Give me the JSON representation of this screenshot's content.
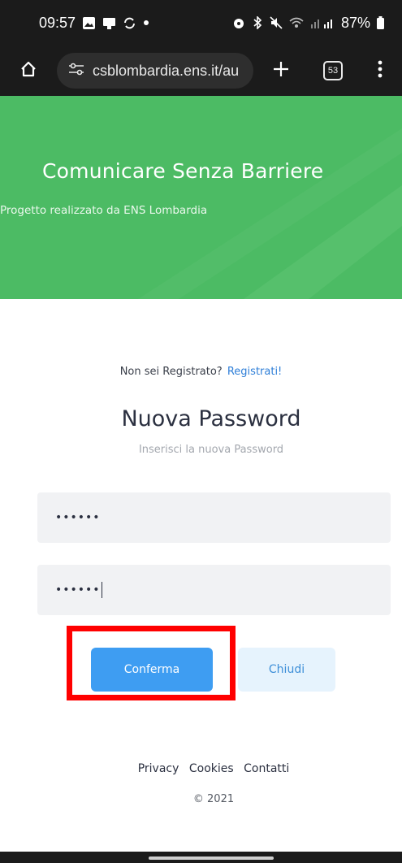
{
  "status_bar": {
    "time": "09:57",
    "battery": "87%"
  },
  "browser": {
    "url": "csblombardia.ens.it/au",
    "tab_count": "53"
  },
  "hero": {
    "title": "Comunicare Senza Barriere",
    "subtitle": "Progetto realizzato da ENS Lombardia",
    "color": "#4cbb64"
  },
  "register": {
    "question": "Non sei Registrato?",
    "link": "Registrati!"
  },
  "form": {
    "title": "Nuova Password",
    "subtitle": "Inserisci la nuova Password",
    "password_value": "••••••",
    "confirm_value": "••••••",
    "confirm_button": "Conferma",
    "close_button": "Chiudi"
  },
  "footer": {
    "links": [
      "Privacy",
      "Cookies",
      "Contatti"
    ],
    "copyright": "© 2021"
  },
  "colors": {
    "primary": "#3e9df2",
    "highlight": "#ff0000"
  }
}
